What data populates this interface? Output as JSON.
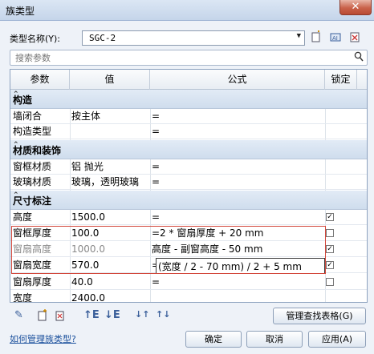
{
  "window": {
    "title": "族类型",
    "close_label": "✕"
  },
  "type_name": {
    "label": "类型名称(Y):",
    "value": "SGC-2"
  },
  "search": {
    "placeholder": "搜索参数"
  },
  "columns": {
    "param": "参数",
    "value": "值",
    "formula": "公式",
    "lock": "锁定"
  },
  "groups": {
    "g1": "构造",
    "g2": "材质和装饰",
    "g3": "尺寸标注"
  },
  "rows": {
    "r1": {
      "param": "墙闭合",
      "value": "按主体",
      "formula": "="
    },
    "r2": {
      "param": "构造类型",
      "value": "",
      "formula": "="
    },
    "r3": {
      "param": "窗框材质",
      "value": "铝 抛光",
      "formula": "="
    },
    "r4": {
      "param": "玻璃材质",
      "value": "玻璃，透明玻璃",
      "formula": "="
    },
    "r5": {
      "param": "高度",
      "value": "1500.0",
      "formula": "="
    },
    "r6": {
      "param": "窗框厚度",
      "value": "100.0",
      "formula": "=2 * 窗扇厚度 + 20 mm"
    },
    "r7": {
      "param": "窗扇高度",
      "value": "1000.0",
      "formula": "高度 - 副窗高度 - 50 mm"
    },
    "r8": {
      "param": "窗扇宽度",
      "value": "570.0",
      "formula": "=",
      "formula_edit": "(宽度 / 2 - 70 mm) / 2 + 5 mm"
    },
    "r9": {
      "param": "窗扇厚度",
      "value": "40.0",
      "formula": "="
    },
    "r10": {
      "param": "宽度",
      "value": "2400.0",
      "formula": ""
    }
  },
  "toolbar_bottom": {
    "manage_lookup": "管理查找表格(G)"
  },
  "help_link": "如何管理族类型?",
  "buttons": {
    "ok": "确定",
    "cancel": "取消",
    "apply": "应用(A)"
  },
  "icons": [
    "pencil-icon",
    "new-param-icon",
    "delete-param-icon",
    "move-up-icon",
    "move-down-icon",
    "sort-asc-icon",
    "sort-desc-icon"
  ]
}
